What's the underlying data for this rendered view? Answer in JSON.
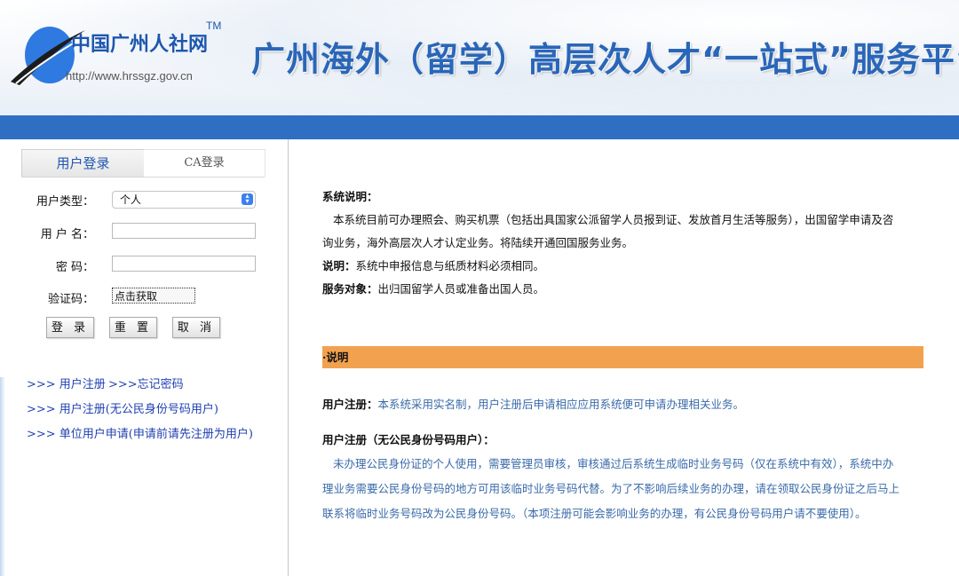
{
  "header": {
    "logo_text": "中国广州人社网",
    "logo_tm": "TM",
    "logo_url": "http://www.hrssgz.gov.cn",
    "title": "广州海外（留学）高层次人才“一站式”服务平台"
  },
  "login": {
    "tabs": [
      "用户登录",
      "CA登录"
    ],
    "user_type_label": "用户类型：",
    "user_type_value": "个人",
    "username_label": "用 户 名：",
    "password_label": "密 码：",
    "captcha_label": "验证码：",
    "captcha_button": "点击获取",
    "login_button": "登 录",
    "reset_button": "重 置",
    "cancel_button": "取 消"
  },
  "links": {
    "register": ">>> 用户注册",
    "forgot": ">>>忘记密码",
    "register_no_id": ">>> 用户注册(无公民身份号码用户)",
    "unit_apply": ">>> 单位用户申请(申请前请先注册为用户)"
  },
  "content": {
    "sys_heading": "系统说明：",
    "sys_line1": "本系统目前可办理照会、购买机票（包括出具国家公派留学人员报到证、发放首月生活等服务），出国留学申请及咨",
    "sys_line2": "询业务，海外高层次人才认定业务。将陆续开通回国服务业务。",
    "note_label": "说明：",
    "note_text": "系统中申报信息与纸质材料必须相同。",
    "target_label": "服务对象：",
    "target_text": "出归国留学人员或准备出国人员。",
    "bar_label": "·说明",
    "reg_label": "用户注册：",
    "reg_text": "本系统采用实名制，用户注册后申请相应应用系统便可申请办理相关业务。",
    "reg2_heading": "用户注册（无公民身份号码用户）：",
    "reg2_line1": "未办理公民身份证的个人使用，需要管理员审核，审核通过后系统生成临时业务号码（仅在系统中有效），系统中办",
    "reg2_line2": "理业务需要公民身份号码的地方可用该临时业务号码代替。为了不影响后续业务的办理，请在领取公民身份证之后马上",
    "reg2_line3": "联系将临时业务号码改为公民身份号码。（本项注册可能会影响业务的办理，有公民身份号码用户请不要使用）。"
  },
  "colors": {
    "band": "#2f6fc3",
    "bar": "#f2a24f",
    "link": "#1f3fb0"
  }
}
